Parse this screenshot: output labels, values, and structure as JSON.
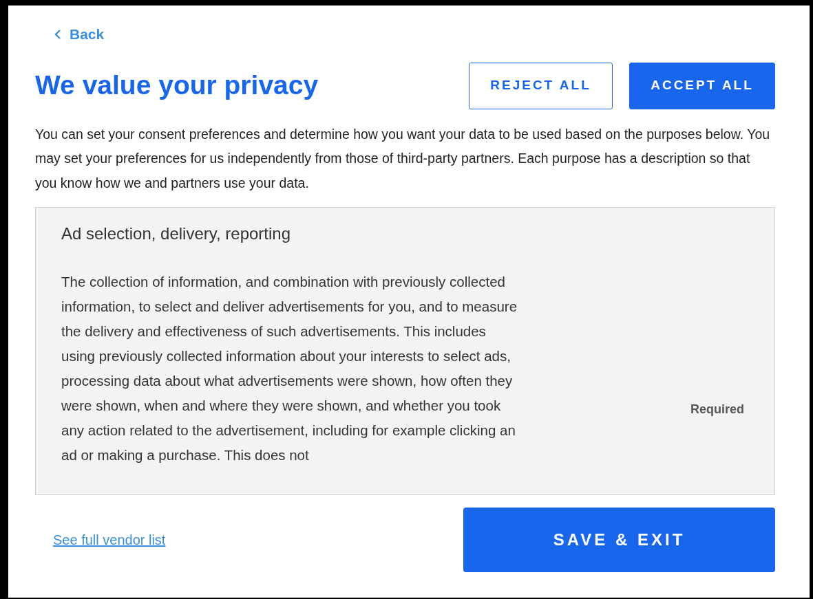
{
  "back": {
    "label": "Back"
  },
  "title": "We value your privacy",
  "buttons": [
    {
      "label": "REJECT ALL",
      "kind": "outline"
    },
    {
      "label": "ACCEPT ALL",
      "kind": "filled"
    }
  ],
  "intro": "You can set your consent preferences and determine how you want your data to be used based on the purposes below. You may set your preferences for us independently from those of third-party partners. Each purpose has a description so that you know how we and partners use your data.",
  "purpose": {
    "title": "Ad selection, delivery, reporting",
    "description": "The collection of information, and combination with previously collected information, to select and deliver advertisements for you, and to measure the delivery and effectiveness of such advertisements. This includes using previously collected information about your interests to select ads, processing data about what advertisements were shown, how often they were shown, when and where they were shown, and whether you took any action related to the advertisement, including for example clicking an ad or making a purchase. This does not",
    "status": "Required"
  },
  "vendor_link": "See full vendor list",
  "save_button": "SAVE & EXIT"
}
